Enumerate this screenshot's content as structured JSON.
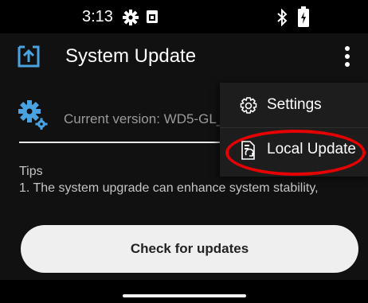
{
  "status_bar": {
    "time": "3:13",
    "icons": [
      "gear-icon",
      "sim-card-icon",
      "bluetooth-icon",
      "battery-charging-icon"
    ]
  },
  "app_bar": {
    "title": "System Update",
    "app_icon": "upload-box-icon",
    "overflow_icon": "more-vertical-icon"
  },
  "main": {
    "version_text": "Current version: WD5-GL_",
    "tips_title": "Tips",
    "tips_line_1": "1. The system upgrade can enhance system stability,",
    "check_button_label": "Check for updates"
  },
  "overflow_menu": {
    "items": [
      {
        "label": "Settings",
        "icon": "gear-outline-icon"
      },
      {
        "label": "Local Update",
        "icon": "local-file-update-icon",
        "highlighted": true
      }
    ]
  },
  "colors": {
    "background": "#111111",
    "menu_background": "#1d1d1d",
    "accent_blue": "#4aa3e0",
    "highlight_red": "#e40000",
    "button": "#efefef"
  }
}
